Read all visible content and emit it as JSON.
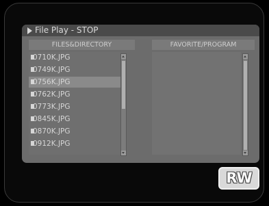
{
  "header": {
    "title": "File Play - STOP"
  },
  "files": {
    "header": "FILES&DIRECTORY",
    "items": [
      {
        "name": "0710K.JPG"
      },
      {
        "name": "0749K.JPG"
      },
      {
        "name": "0756K.JPG",
        "selected": true
      },
      {
        "name": "0762K.JPG"
      },
      {
        "name": "0773K.JPG"
      },
      {
        "name": "0845K.JPG"
      },
      {
        "name": "0870K.JPG"
      },
      {
        "name": "0912K.JPG"
      }
    ]
  },
  "favorites": {
    "header": "FAVORITE/PROGRAM",
    "items": []
  },
  "badge": {
    "label": "RW"
  },
  "icons": {
    "title_marker": "play-triangle-icon",
    "file": "file-icon",
    "scroll_up": "arrow-up-icon",
    "scroll_down": "arrow-down-icon"
  },
  "colors": {
    "background": "#000000",
    "panel": "#6c6c6c",
    "title_bar": "#4a4a4a",
    "selected_row": "#8a8a8a",
    "text": "#d6d6d6"
  }
}
